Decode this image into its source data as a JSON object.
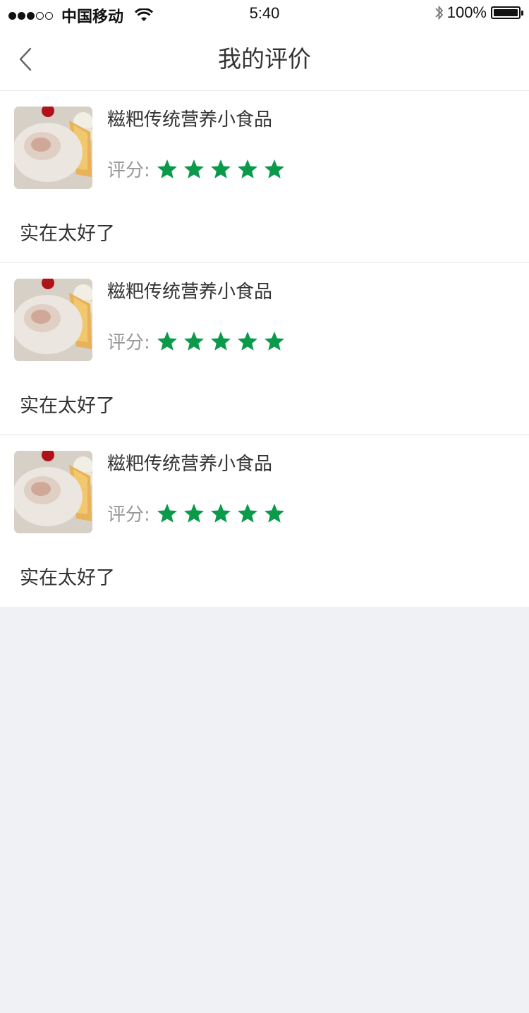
{
  "status_bar": {
    "carrier": "中国移动",
    "time": "5:40",
    "battery": "100%",
    "signal_filled": 3,
    "signal_empty": 2
  },
  "nav": {
    "title": "我的评价",
    "back_icon": "chevron-left-icon"
  },
  "colors": {
    "star": "#0a9a4a",
    "background": "#f0f1f5"
  },
  "reviews": [
    {
      "product_name": "糍粑传统营养小食品",
      "rating_label": "评分:",
      "rating": 5,
      "text": "实在太好了"
    },
    {
      "product_name": "糍粑传统营养小食品",
      "rating_label": "评分:",
      "rating": 5,
      "text": "实在太好了"
    },
    {
      "product_name": "糍粑传统营养小食品",
      "rating_label": "评分:",
      "rating": 5,
      "text": "实在太好了"
    }
  ]
}
